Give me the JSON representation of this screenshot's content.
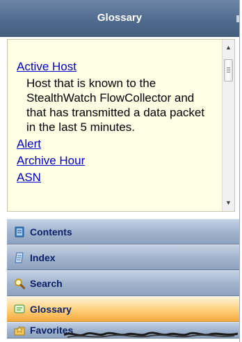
{
  "header": {
    "title": "Glossary"
  },
  "glossary": {
    "entries": [
      {
        "term": "Active Host",
        "definition": "Host that is known to the StealthWatch FlowCollector and that has transmitted a data packet in the last 5 minutes."
      },
      {
        "term": "Alert"
      },
      {
        "term": "Archive Hour"
      },
      {
        "term": "ASN"
      }
    ]
  },
  "tabs": {
    "items": [
      {
        "label": "Contents",
        "icon": "book-icon"
      },
      {
        "label": "Index",
        "icon": "index-page-icon"
      },
      {
        "label": "Search",
        "icon": "magnifier-icon"
      },
      {
        "label": "Glossary",
        "icon": "glossary-icon"
      },
      {
        "label": "Favorites",
        "icon": "star-folder-icon"
      }
    ],
    "active": "Glossary"
  },
  "colors": {
    "header": "#4f6b8e",
    "tab": "#9fb2cc",
    "active_tab": "#ffcf7a",
    "content_background": "#ffffe6",
    "link": "#0000cc",
    "tab_text": "#0b1f66"
  }
}
